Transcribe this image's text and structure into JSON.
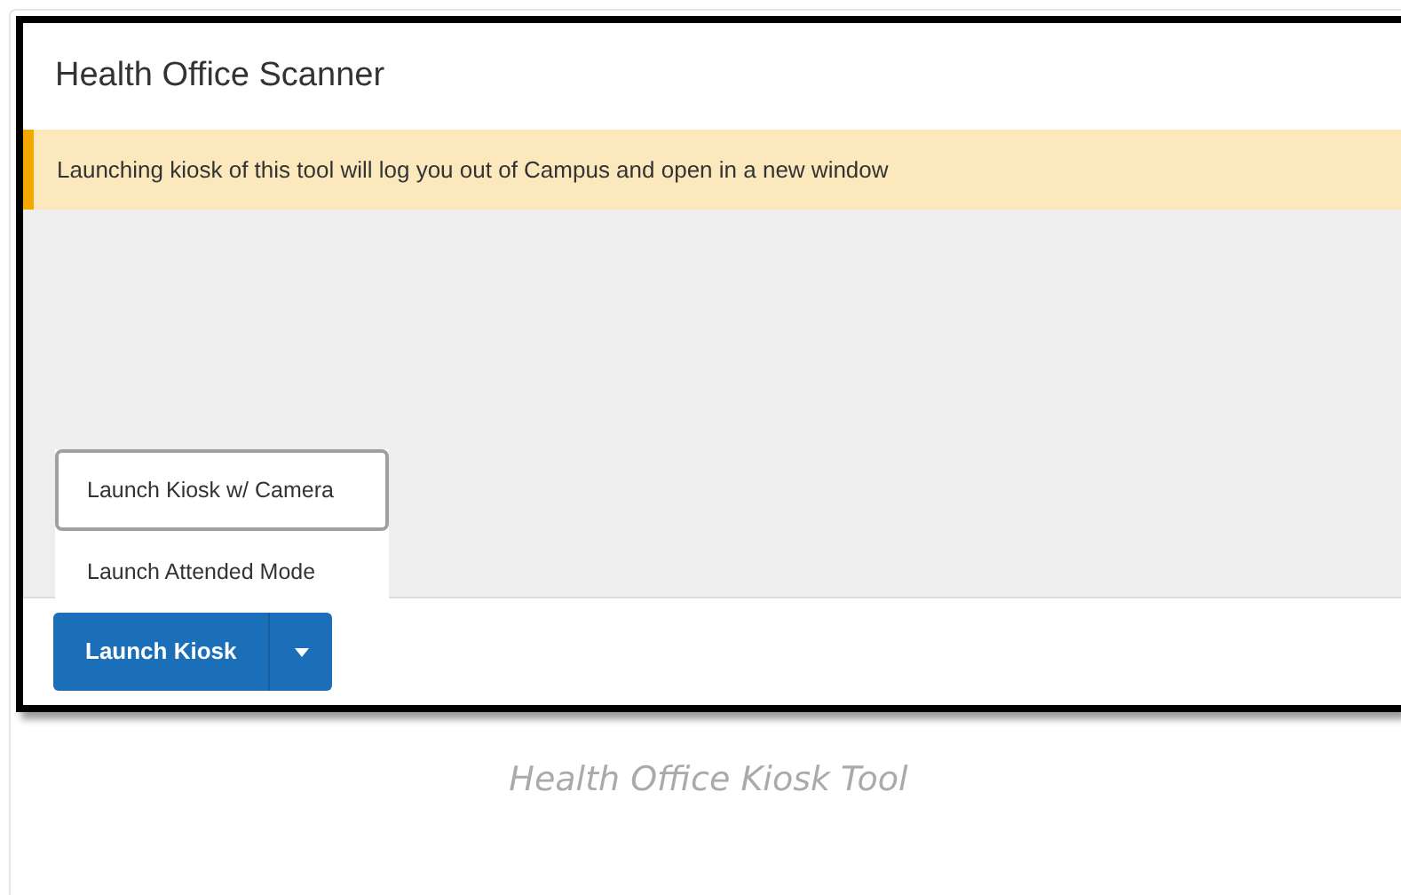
{
  "window": {
    "title": "Health Office Scanner"
  },
  "banner": {
    "message": "Launching kiosk of this tool will log you out of Campus and open in a new window"
  },
  "menu": {
    "items": [
      {
        "label": "Launch Kiosk w/ Camera",
        "selected": true
      },
      {
        "label": "Launch Attended Mode",
        "selected": false
      }
    ]
  },
  "split_button": {
    "label": "Launch Kiosk"
  },
  "caption": "Health Office Kiosk Tool"
}
